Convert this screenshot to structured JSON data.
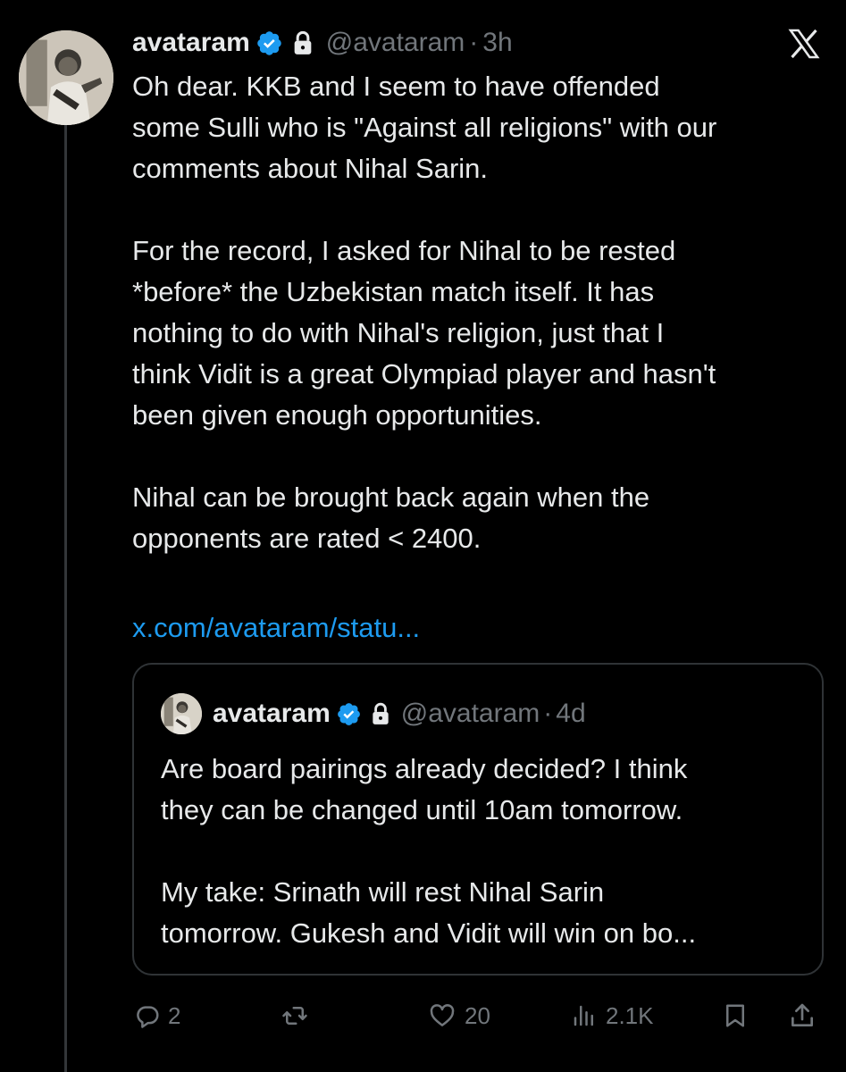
{
  "tweet": {
    "author_name": "avataram",
    "handle": "@avataram",
    "separator": "·",
    "time": "3h",
    "body": "Oh dear. KKB and I seem to have offended\nsome Sulli who is \"Against all religions\" with our\ncomments about Nihal Sarin.\n\nFor the record, I asked for Nihal to be rested\n*before* the Uzbekistan match itself. It has\nnothing to do with Nihal's religion, just that I\nthink Vidit is a great Olympiad player and hasn't\nbeen given enough opportunities.\n\nNihal can be brought back again when the\nopponents are rated < 2400.",
    "link": "x.com/avataram/statu..."
  },
  "quoted_tweet": {
    "author_name": "avataram",
    "handle": "@avataram",
    "separator": "·",
    "time": "4d",
    "body": "Are board pairings already decided? I think\nthey can be changed until 10am tomorrow.\n\nMy take: Srinath will rest Nihal Sarin\ntomorrow. Gukesh and Vidit will win on bo..."
  },
  "actions": {
    "replies": "2",
    "reposts": "",
    "likes": "20",
    "views": "2.1K"
  },
  "icons": {
    "verified": "verified-badge-icon",
    "protected": "lock-icon",
    "brand": "x-logo-icon",
    "reply": "reply-icon",
    "repost": "repost-icon",
    "like": "heart-icon",
    "views": "views-icon",
    "bookmark": "bookmark-icon",
    "share": "share-icon"
  },
  "colors": {
    "background": "#000000",
    "text": "#e7e9ea",
    "muted": "#71767b",
    "link": "#1d9bf0",
    "verified": "#1d9bf0",
    "border": "#2f3336"
  }
}
